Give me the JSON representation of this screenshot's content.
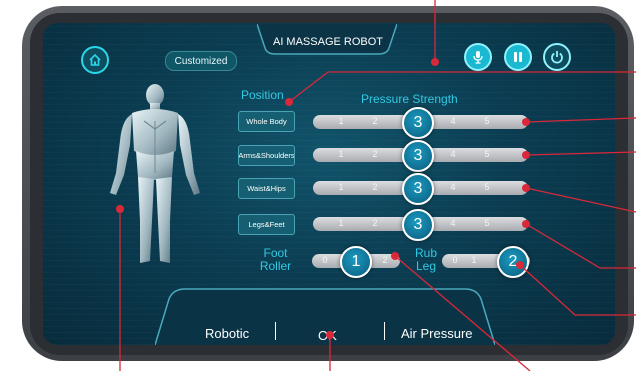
{
  "header": {
    "title": "AI MASSAGE ROBOT",
    "customized_label": "Customized",
    "icons": [
      "home-icon",
      "microphone-icon",
      "pause-icon",
      "power-icon"
    ]
  },
  "position": {
    "label": "Position",
    "items": [
      "Whole Body",
      "Arms&Shoulders",
      "Waist&Hips",
      "Legs&Feet"
    ]
  },
  "pressure": {
    "label": "Pressure Strength",
    "ticks": [
      "1",
      "2",
      "3",
      "4",
      "5"
    ],
    "selected": [
      "3",
      "3",
      "3",
      "3"
    ]
  },
  "foot_roller": {
    "label_line1": "Foot",
    "label_line2": "Roller",
    "ticks": [
      "0",
      "1",
      "2"
    ],
    "selected": "1"
  },
  "rub_leg": {
    "label_line1": "Rub",
    "label_line2": "Leg",
    "ticks": [
      "0",
      "1",
      "2"
    ],
    "selected": "2"
  },
  "bottom": {
    "left": "Robotic",
    "center": "OK",
    "right": "Air Pressure"
  },
  "colors": {
    "accent": "#2ad7e6",
    "callout": "#d9283a",
    "screen_bg": "#0b3d52"
  }
}
